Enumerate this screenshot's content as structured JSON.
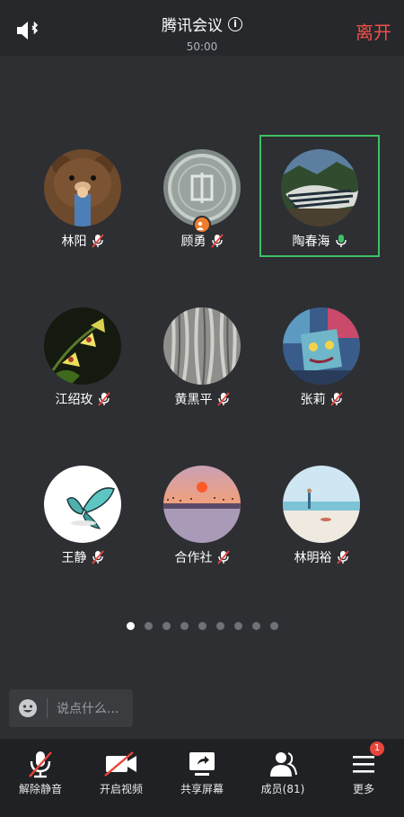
{
  "header": {
    "title": "腾讯会议",
    "timer": "50:00",
    "leave_label": "离开"
  },
  "participants": [
    {
      "name": "林阳",
      "mic": "muted",
      "avatar": "brown-bear-avatar"
    },
    {
      "name": "顾勇",
      "mic": "muted",
      "avatar": "coin-avatar",
      "host": true
    },
    {
      "name": "陶春海",
      "mic": "speaking",
      "avatar": "landscape-avatar",
      "active": true
    },
    {
      "name": "江绍玫",
      "mic": "muted",
      "avatar": "orchid-avatar"
    },
    {
      "name": "黄黑平",
      "mic": "muted",
      "avatar": "tree-trunks-avatar"
    },
    {
      "name": "张莉",
      "mic": "muted",
      "avatar": "painting-avatar"
    },
    {
      "name": "王静",
      "mic": "muted",
      "avatar": "butterfly-avatar"
    },
    {
      "name": "合作社",
      "mic": "muted",
      "avatar": "sunset-avatar"
    },
    {
      "name": "林明裕",
      "mic": "muted",
      "avatar": "beach-avatar"
    }
  ],
  "pagination": {
    "total": 9,
    "current": 1
  },
  "chat": {
    "placeholder": "说点什么..."
  },
  "toolbar": [
    {
      "label": "解除静音",
      "icon": "mic-off-icon"
    },
    {
      "label": "开启视频",
      "icon": "camera-off-icon"
    },
    {
      "label": "共享屏幕",
      "icon": "share-screen-icon"
    },
    {
      "label": "成员(81)",
      "icon": "members-icon"
    },
    {
      "label": "更多",
      "icon": "more-icon",
      "badge": "1"
    }
  ],
  "colors": {
    "accent_green": "#3ec164",
    "leave_red": "#f2504b",
    "mute_red": "#e8453c",
    "background": "#2d2f33"
  }
}
